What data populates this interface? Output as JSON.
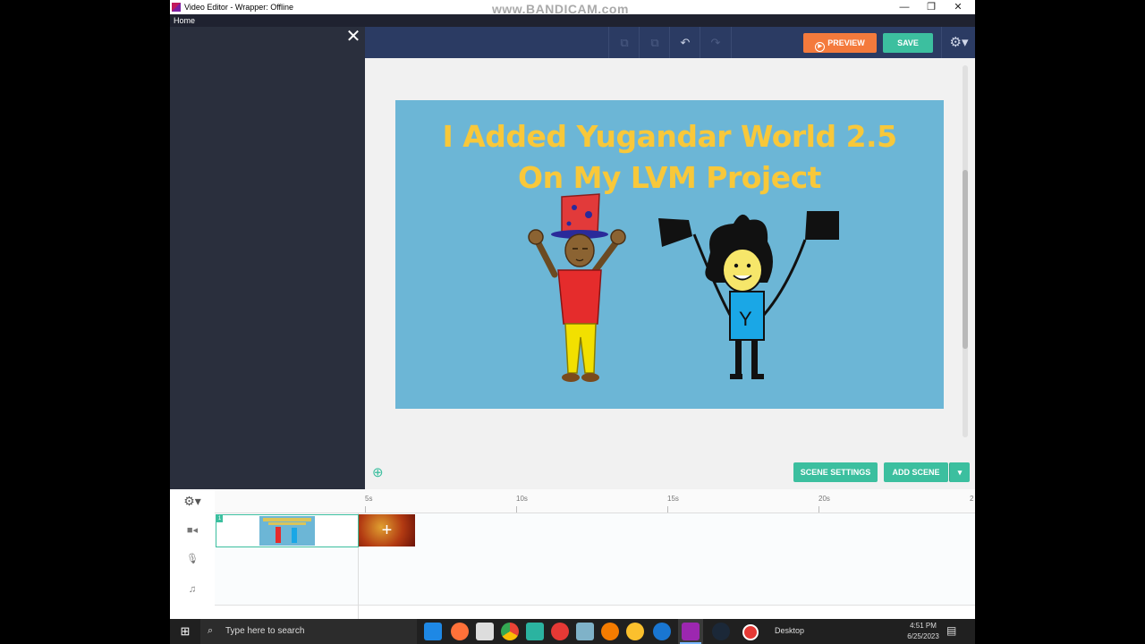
{
  "window": {
    "title": "Video Editor - Wrapper: Offline",
    "watermark": "www.BANDICAM.com",
    "minimize": "—",
    "restore": "❐",
    "close": "✕"
  },
  "menu": {
    "home": "Home"
  },
  "left_panel": {
    "close_glyph": "✕"
  },
  "toolbar": {
    "copy_icon": "⧉",
    "paste_icon": "⧉",
    "undo_icon": "↶",
    "redo_icon": "↷",
    "preview_label": "PREVIEW",
    "save_label": "SAVE",
    "settings_icon": "⚙▾",
    "accent_preview": "#f47a3c",
    "accent_save": "#3cbf9f"
  },
  "scene": {
    "title_line1": "I Added Yugandar World 2.5",
    "title_line2": "On My LVM Project",
    "background": "#6cb6d6",
    "title_color": "#f8c83a",
    "character_right_letter": "Y"
  },
  "stage_controls": {
    "zoom_icon": "⊕",
    "scene_settings": "SCENE SETTINGS",
    "add_scene": "ADD SCENE",
    "add_scene_dropdown": "▾"
  },
  "timeline": {
    "settings_icon": "⚙▾",
    "ticks": [
      "5s",
      "10s",
      "15s",
      "20s",
      "2"
    ],
    "tracks": [
      {
        "icon": "■◂",
        "name": "video-track"
      },
      {
        "icon": "🎙",
        "name": "voice-track"
      },
      {
        "icon": "♫",
        "name": "music-track"
      }
    ],
    "scene_clip_number": "1",
    "add_clip_glyph": "+"
  },
  "taskbar": {
    "start_icon": "⊞",
    "search_icon": "⌕",
    "search_placeholder": "Type here to search",
    "desktop_label": "Desktop",
    "time": "4:51 PM",
    "date": "6/25/2023",
    "notification_icon": "▤",
    "apps": [
      "download-icon",
      "firefox-icon",
      "store-icon",
      "chrome-icon",
      "app-icon",
      "cloud-icon",
      "terminal-icon",
      "vlc-icon",
      "chrome-alt-icon",
      "chrome-blue-icon",
      "wrapper-icon",
      "steam-icon",
      "record-icon"
    ]
  }
}
